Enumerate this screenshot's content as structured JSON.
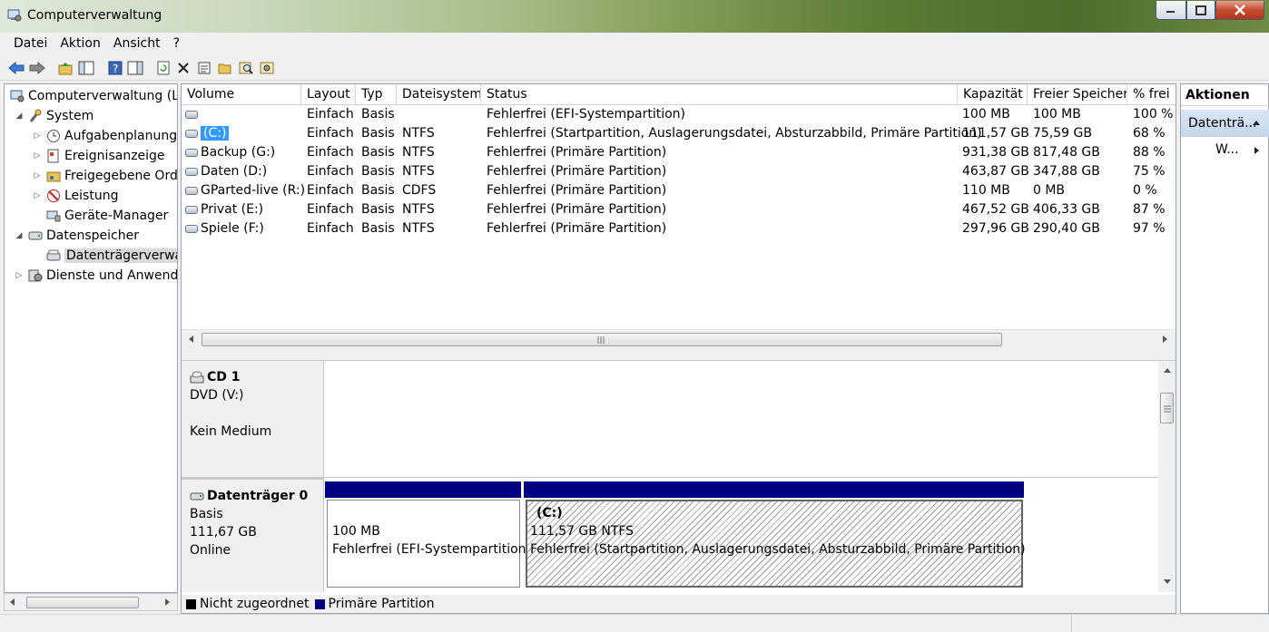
{
  "window": {
    "title": "Computerverwaltung"
  },
  "menu": [
    "Datei",
    "Aktion",
    "Ansicht",
    "?"
  ],
  "tree": {
    "items": [
      {
        "label": "Computerverwaltung (Lokal)",
        "level": 0,
        "arrow": "",
        "icon": "computer-management-icon"
      },
      {
        "label": "System",
        "level": 1,
        "arrow": "◢",
        "icon": "tools-icon"
      },
      {
        "label": "Aufgabenplanung",
        "level": 2,
        "arrow": "▷",
        "icon": "clock-icon"
      },
      {
        "label": "Ereignisanzeige",
        "level": 2,
        "arrow": "▷",
        "icon": "event-viewer-icon"
      },
      {
        "label": "Freigegebene Ordner",
        "level": 2,
        "arrow": "▷",
        "icon": "shared-folder-icon"
      },
      {
        "label": "Leistung",
        "level": 2,
        "arrow": "▷",
        "icon": "performance-icon"
      },
      {
        "label": "Geräte-Manager",
        "level": 2,
        "arrow": "",
        "icon": "device-manager-icon"
      },
      {
        "label": "Datenspeicher",
        "level": 1,
        "arrow": "◢",
        "icon": "storage-icon"
      },
      {
        "label": "Datenträgerverwaltung",
        "level": 2,
        "arrow": "",
        "icon": "disk-management-icon",
        "selected": true
      },
      {
        "label": "Dienste und Anwendungen",
        "level": 1,
        "arrow": "▷",
        "icon": "services-icon"
      }
    ]
  },
  "table": {
    "headers": [
      "Volume",
      "Layout",
      "Typ",
      "Dateisystem",
      "Status",
      "Kapazität",
      "Freier Speicher",
      "% frei"
    ],
    "rows": [
      {
        "volume": "",
        "layout": "Einfach",
        "typ": "Basis",
        "fs": "",
        "status": "Fehlerfrei (EFI-Systempartition)",
        "cap": "100 MB",
        "free": "100 MB",
        "pct": "100 %"
      },
      {
        "volume": "(C:)",
        "layout": "Einfach",
        "typ": "Basis",
        "fs": "NTFS",
        "status": "Fehlerfrei (Startpartition, Auslagerungsdatei, Absturzabbild, Primäre Partition)",
        "cap": "111,57 GB",
        "free": "75,59 GB",
        "pct": "68 %",
        "selected": true
      },
      {
        "volume": "Backup (G:)",
        "layout": "Einfach",
        "typ": "Basis",
        "fs": "NTFS",
        "status": "Fehlerfrei (Primäre Partition)",
        "cap": "931,38 GB",
        "free": "817,48 GB",
        "pct": "88 %"
      },
      {
        "volume": "Daten (D:)",
        "layout": "Einfach",
        "typ": "Basis",
        "fs": "NTFS",
        "status": "Fehlerfrei (Primäre Partition)",
        "cap": "463,87 GB",
        "free": "347,88 GB",
        "pct": "75 %"
      },
      {
        "volume": "GParted-live (R:)",
        "layout": "Einfach",
        "typ": "Basis",
        "fs": "CDFS",
        "status": "Fehlerfrei (Primäre Partition)",
        "cap": "110 MB",
        "free": "0 MB",
        "pct": "0 %",
        "cdrom": true
      },
      {
        "volume": "Privat (E:)",
        "layout": "Einfach",
        "typ": "Basis",
        "fs": "NTFS",
        "status": "Fehlerfrei (Primäre Partition)",
        "cap": "467,52 GB",
        "free": "406,33 GB",
        "pct": "87 %"
      },
      {
        "volume": "Spiele (F:)",
        "layout": "Einfach",
        "typ": "Basis",
        "fs": "NTFS",
        "status": "Fehlerfrei (Primäre Partition)",
        "cap": "297,96 GB",
        "free": "290,40 GB",
        "pct": "97 %"
      }
    ]
  },
  "disks": {
    "cd1": {
      "title": "CD 1",
      "line1": "DVD (V:)",
      "line2": "Kein Medium"
    },
    "disk0": {
      "title": "Datenträger 0",
      "type": "Basis",
      "size": "111,67 GB",
      "state": "Online",
      "partitions": [
        {
          "name": "",
          "size": "100 MB",
          "status": "Fehlerfrei (EFI-Systempartition)"
        },
        {
          "name": "(C:)",
          "size": "111,57 GB NTFS",
          "status": "Fehlerfrei (Startpartition, Auslagerungsdatei, Absturzabbild, Primäre Partition)"
        }
      ]
    }
  },
  "legend": {
    "unallocated": "Nicht zugeordnet",
    "primary": "Primäre Partition",
    "unallocated_color": "#000000",
    "primary_color": "#000080"
  },
  "actions": {
    "title": "Aktionen",
    "group": "Datenträ...",
    "item": "W..."
  }
}
